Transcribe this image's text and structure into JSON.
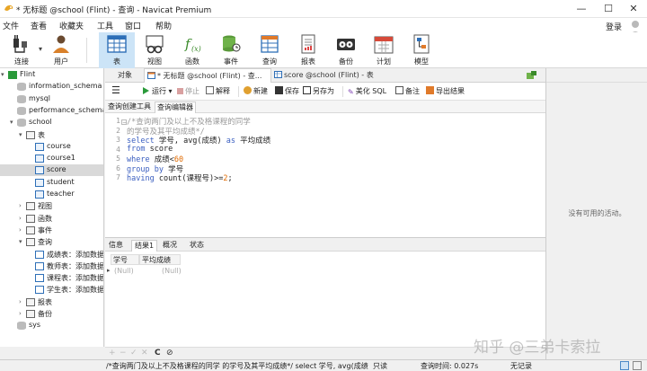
{
  "window": {
    "title": "* 无标题 @school (Flint) - 查询 - Navicat Premium",
    "minimize": "—",
    "maximize": "☐",
    "close": "✕"
  },
  "menu": [
    "文件",
    "查看",
    "收藏夹",
    "工具",
    "窗口",
    "帮助"
  ],
  "login": "登录",
  "toolbar": [
    {
      "label": "连接",
      "icon": "connect-icon"
    },
    {
      "label": "用户",
      "icon": "user-icon"
    },
    {
      "label": "表",
      "icon": "table-icon"
    },
    {
      "label": "视图",
      "icon": "view-icon"
    },
    {
      "label": "函数",
      "icon": "function-icon"
    },
    {
      "label": "事件",
      "icon": "event-icon"
    },
    {
      "label": "查询",
      "icon": "query-icon"
    },
    {
      "label": "报表",
      "icon": "report-icon"
    },
    {
      "label": "备份",
      "icon": "backup-icon"
    },
    {
      "label": "计划",
      "icon": "schedule-icon"
    },
    {
      "label": "模型",
      "icon": "model-icon"
    }
  ],
  "tree": [
    {
      "label": "Flint",
      "type": "connection",
      "expanded": true
    },
    {
      "label": "information_schema",
      "type": "db"
    },
    {
      "label": "mysql",
      "type": "db"
    },
    {
      "label": "performance_schema",
      "type": "db"
    },
    {
      "label": "school",
      "type": "db",
      "expanded": true
    },
    {
      "label": "表",
      "type": "folder",
      "expanded": true
    },
    {
      "label": "course",
      "type": "table"
    },
    {
      "label": "course1",
      "type": "table"
    },
    {
      "label": "score",
      "type": "table",
      "selected": true
    },
    {
      "label": "student",
      "type": "table"
    },
    {
      "label": "teacher",
      "type": "table"
    },
    {
      "label": "视图",
      "type": "folder"
    },
    {
      "label": "函数",
      "type": "folder"
    },
    {
      "label": "事件",
      "type": "folder"
    },
    {
      "label": "查询",
      "type": "folder",
      "expanded": true
    },
    {
      "label": "成绩表：添加数据",
      "type": "query"
    },
    {
      "label": "教师表：添加数据",
      "type": "query"
    },
    {
      "label": "课程表：添加数据",
      "type": "query"
    },
    {
      "label": "学生表：添加数据",
      "type": "query"
    },
    {
      "label": "报表",
      "type": "folder"
    },
    {
      "label": "备份",
      "type": "folder"
    },
    {
      "label": "sys",
      "type": "db"
    }
  ],
  "tabs": {
    "objects": "对象",
    "active": "* 无标题 @school (Flint) - 查...",
    "other": "score @school (Flint) - 表"
  },
  "query_toolbar": {
    "run": "运行",
    "run_arrow": "▾",
    "stop": "停止",
    "explain": "解释",
    "new": "新建",
    "save": "保存",
    "save_as": "另存为",
    "beautify": "美化 SQL",
    "notes": "备注",
    "export": "导出结果"
  },
  "subtabs": [
    "查询创建工具",
    "查询编辑器"
  ],
  "editor": {
    "line_numbers": [
      "1",
      "2",
      "3",
      "4",
      "5",
      "6",
      "7"
    ],
    "lines": [
      {
        "parts": [
          {
            "t": "/*查询两门及以上不及格课程的同学",
            "c": "comment"
          }
        ]
      },
      {
        "parts": [
          {
            "t": "的学号及其平均成绩*/",
            "c": "comment"
          }
        ]
      },
      {
        "parts": [
          {
            "t": "select",
            "c": "kw"
          },
          {
            "t": " 学号, avg(成绩) ",
            "c": "txt"
          },
          {
            "t": "as",
            "c": "kw"
          },
          {
            "t": " 平均成绩",
            "c": "txt"
          }
        ]
      },
      {
        "parts": [
          {
            "t": "from",
            "c": "kw"
          },
          {
            "t": " score",
            "c": "txt"
          }
        ]
      },
      {
        "parts": [
          {
            "t": "where",
            "c": "kw"
          },
          {
            "t": " 成绩<",
            "c": "txt"
          },
          {
            "t": "60",
            "c": "num"
          }
        ]
      },
      {
        "parts": [
          {
            "t": "group by",
            "c": "kw"
          },
          {
            "t": " 学号",
            "c": "txt"
          }
        ]
      },
      {
        "parts": [
          {
            "t": "having",
            "c": "kw"
          },
          {
            "t": " count(课程号)>=",
            "c": "txt"
          },
          {
            "t": "2",
            "c": "num"
          },
          {
            "t": ";",
            "c": "txt"
          }
        ]
      }
    ]
  },
  "result_tabs": [
    "信息",
    "结果1",
    "概况",
    "状态"
  ],
  "result_grid": {
    "columns": [
      "学号",
      "平均成绩"
    ],
    "rows": [
      [
        "(Null)",
        "(Null)"
      ]
    ]
  },
  "grid_buttons": [
    "+",
    "−",
    "✓",
    "✕",
    "C",
    "⊘"
  ],
  "right_panel": {
    "empty_message": "没有可用的活动。"
  },
  "watermark": "知乎 @三弟卡索拉",
  "status": {
    "sql_preview": "/*查询两门及以上不及格课程的同学 的学号及其平均成绩*/ select 学号, avg(成绩",
    "mode": "只读",
    "query_time": "查询时间: 0.027s",
    "records": "无记录"
  },
  "colors": {
    "accent": "#3b5fc0",
    "active_tab_bg": "#cce4f7",
    "selected_row": "#d9d9d9"
  }
}
